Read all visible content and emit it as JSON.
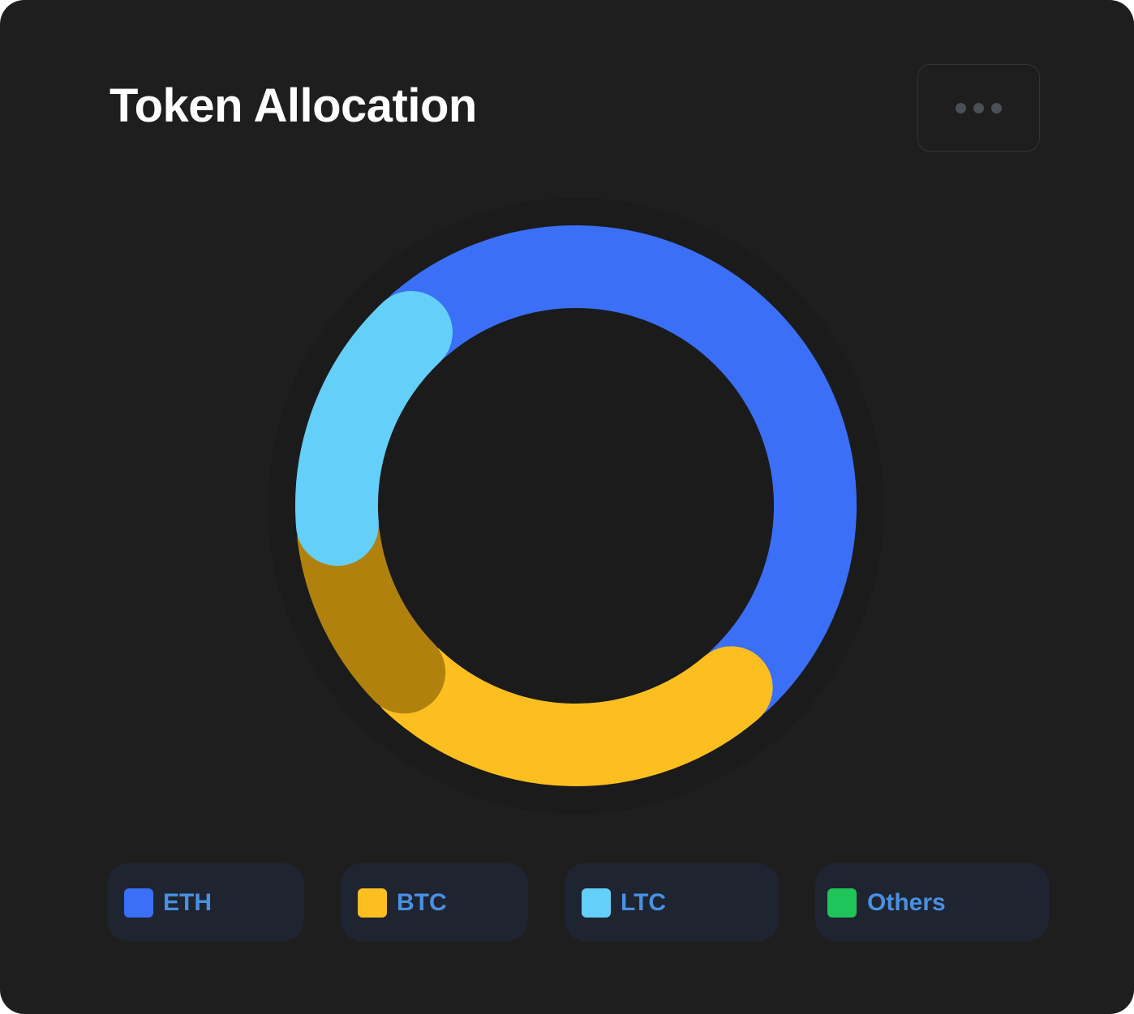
{
  "card": {
    "title": "Token Allocation"
  },
  "menu": {
    "icon": "more-horizontal-icon"
  },
  "colors": {
    "card_background": "#1e1e1e",
    "legend_background": "#1f2431",
    "legend_text": "#4a90e2"
  },
  "legend": [
    {
      "label": "ETH",
      "color": "#3b6ff8"
    },
    {
      "label": "BTC",
      "color": "#fdbf20"
    },
    {
      "label": "LTC",
      "color": "#64cff8"
    },
    {
      "label": "Others",
      "color": "#1fc55a"
    }
  ],
  "chart_data": {
    "type": "pie",
    "variant": "donut",
    "title": "Token Allocation",
    "start_angle_deg": -132,
    "slices": [
      {
        "label": "ETH",
        "value": 50,
        "color": "#3b6ff8"
      },
      {
        "label": "BTC",
        "value": 24,
        "color": "#fdbf20"
      },
      {
        "label": "",
        "value": 11,
        "color": "#b0820d"
      },
      {
        "label": "LTC",
        "value": 15,
        "color": "#64cff8"
      }
    ],
    "legend_position": "bottom"
  }
}
